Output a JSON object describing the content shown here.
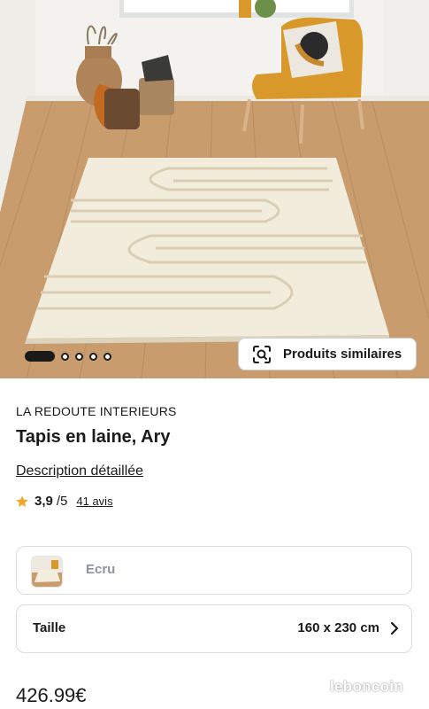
{
  "gallery": {
    "page_count": 5,
    "current_page": 1,
    "similar_button_label": "Produits similaires",
    "similar_icon": "visual-search-icon"
  },
  "product": {
    "brand": "LA REDOUTE INTERIEURS",
    "title": "Tapis en laine, Ary",
    "description_link": "Description détaillée",
    "rating": {
      "score": "3,9",
      "max": "/5",
      "reviews": "41 avis",
      "star_color": "#f0a727"
    },
    "color": {
      "value": "Ecru"
    },
    "size": {
      "label": "Taille",
      "value": "160 x 230 cm"
    },
    "price": "426.99€"
  },
  "watermark": "leboncoin"
}
